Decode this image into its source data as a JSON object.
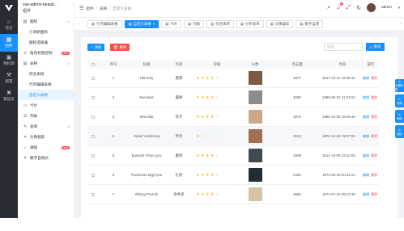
{
  "nav_rail": {
    "items": [
      {
        "label": "首页",
        "icon": "home-icon",
        "glyph": "⌂"
      },
      {
        "label": "组件",
        "icon": "grid-icon",
        "glyph": "▦"
      },
      {
        "label": "物料源",
        "icon": "cube-icon",
        "glyph": "▣"
      },
      {
        "label": "配置",
        "icon": "wrench-icon",
        "glyph": "⚒"
      },
      {
        "label": "错误页",
        "icon": "bug-icon",
        "glyph": "✖"
      }
    ]
  },
  "sidebar": {
    "title": "vue-admin-beauti...",
    "subtitle": "组件",
    "items": [
      {
        "label": "图标",
        "icon": "image-icon",
        "glyph": "▧",
        "type": "group",
        "caret": "∧"
      },
      {
        "label": "小清新图标",
        "type": "sub"
      },
      {
        "label": "图标选择器",
        "type": "sub"
      },
      {
        "label": "角色权限控制",
        "icon": "user-icon",
        "glyph": "♙",
        "type": "group",
        "badge": "new"
      },
      {
        "label": "表格",
        "icon": "table-icon",
        "glyph": "▤",
        "type": "group",
        "caret": "∧"
      },
      {
        "label": "综合表格",
        "type": "sub"
      },
      {
        "label": "行内编辑表格",
        "type": "sub"
      },
      {
        "label": "自定义表格",
        "type": "sub",
        "active": true
      },
      {
        "label": "卡片",
        "icon": "card-icon",
        "glyph": "▭",
        "type": "group"
      },
      {
        "label": "列表",
        "icon": "list-icon",
        "glyph": "☰",
        "type": "group"
      },
      {
        "label": "表单",
        "icon": "form-icon",
        "glyph": "✎",
        "type": "group",
        "caret": "∨"
      },
      {
        "label": "头像裁剪",
        "icon": "crop-icon",
        "glyph": "⌗",
        "type": "group"
      },
      {
        "label": "通知",
        "icon": "bell-icon",
        "glyph": "♪",
        "type": "group",
        "badge": "new"
      },
      {
        "label": "数字自增长",
        "icon": "number-icon",
        "glyph": "#",
        "type": "group"
      }
    ]
  },
  "topbar": {
    "breadcrumb": [
      "组件",
      "表格",
      "自定义表格"
    ],
    "badge_count": "5",
    "user": "admin"
  },
  "tabs": [
    {
      "label": "行内编辑表格"
    },
    {
      "label": "自定义表格",
      "active": true
    },
    {
      "label": "卡片"
    },
    {
      "label": "列表"
    },
    {
      "label": "综合表单"
    },
    {
      "label": "分步表单"
    },
    {
      "label": "头像裁剪"
    },
    {
      "label": "数字自增"
    }
  ],
  "toolbar": {
    "add_label": "添加",
    "delete_label": "删除",
    "search_placeholder": "标题",
    "search_label": "查询"
  },
  "table": {
    "headers": [
      "序号",
      "标题",
      "作者",
      "评级",
      "头像",
      "点击量",
      "时间",
      "操作"
    ],
    "rows": [
      {
        "index": "1",
        "title": "HhLXely",
        "author": "夏静",
        "rating": 4,
        "pv": "2877",
        "time": "2017-10-11 12:06:42",
        "cover_color": "#7a5a44"
      },
      {
        "index": "2",
        "title": "Ewxukyk",
        "author": "董峰",
        "rating": 4,
        "pv": "4088",
        "time": "1990-05-01 21:34:04",
        "cover_color": "#8c8c8c"
      },
      {
        "index": "3",
        "title": "Wmovlpt",
        "author": "贺芳",
        "rating": 4,
        "pv": "2970",
        "time": "1996-12-02 19:48:45",
        "cover_color": "#c9a98a"
      },
      {
        "index": "4",
        "title": "Vsduf Vsmkmnq",
        "author": "乔杰",
        "rating": 1,
        "pv": "2012",
        "time": "1974-12-04 01:07:03",
        "cover_color": "#a07050",
        "highlight": true
      },
      {
        "index": "5",
        "title": "Epssdyf Vfnyu jyxx",
        "author": "董明",
        "rating": 4,
        "pv": "1608",
        "time": "2012-10-09 23:22:05",
        "cover_color": "#3f4a55"
      },
      {
        "index": "6",
        "title": "Popseusu Mgjl iyxa",
        "author": "孔丽",
        "rating": 4,
        "pv": "2492",
        "time": "1974-08-15 00:34:24",
        "cover_color": "#262c33"
      },
      {
        "index": "7",
        "title": "Wbsyyl Pezmk",
        "author": "余秀英",
        "rating": 4,
        "pv": "2660",
        "time": "1971-07-12 09:12:36",
        "cover_color": "#d8c2a6"
      }
    ],
    "op_edit": "编辑",
    "op_delete": "删除"
  },
  "float_tabs": [
    {
      "label": "主题配置"
    },
    {
      "label": "布局"
    },
    {
      "label": "刷新"
    },
    {
      "label": "返回"
    }
  ]
}
